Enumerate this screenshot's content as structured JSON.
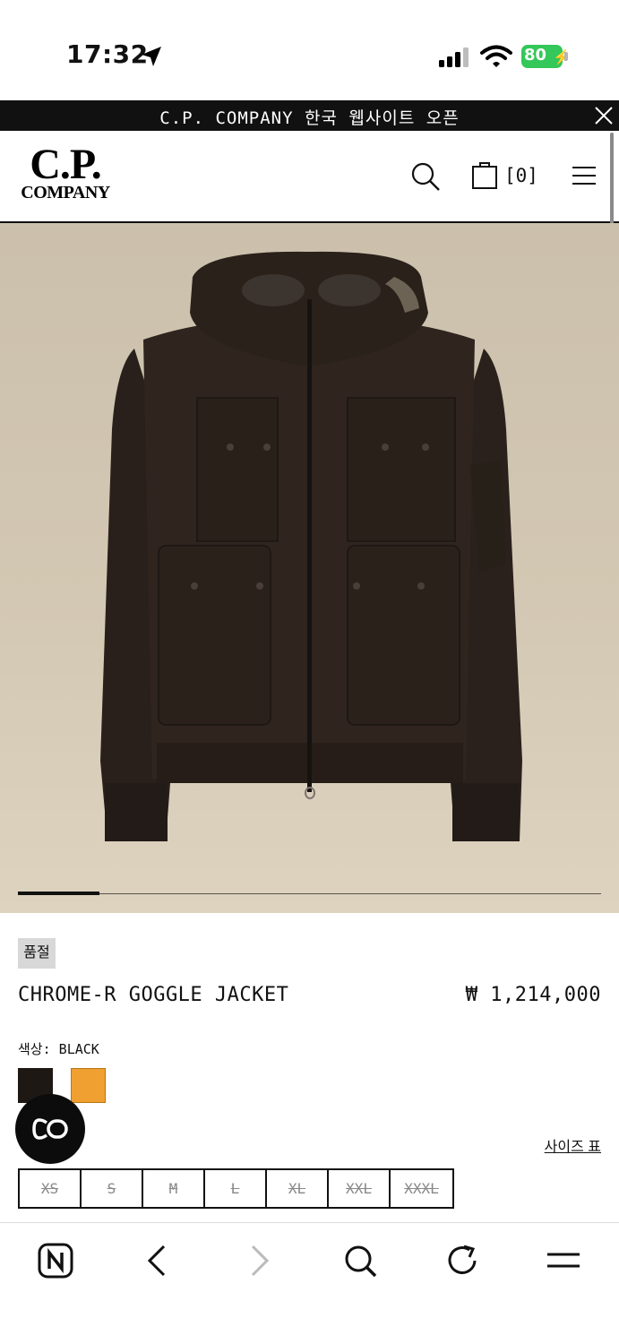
{
  "status_bar": {
    "time": "17:32",
    "battery": "80"
  },
  "announcement": {
    "text": "C.P. COMPANY 한국 웹사이트 오픈"
  },
  "header": {
    "logo_line1": "C.P.",
    "logo_line2": "COMPANY",
    "cart_count": "[0]"
  },
  "gallery": {
    "progress": 0.14
  },
  "product": {
    "badge": "품절",
    "name": "CHROME-R GOGGLE JACKET",
    "price": "₩ 1,214,000",
    "color_label": "색상: BLACK",
    "swatches": [
      {
        "name": "black",
        "hex": "#1e1815"
      },
      {
        "name": "orange",
        "hex": "#f0a030"
      }
    ],
    "size_chart_label": "사이즈 표",
    "sizes": [
      {
        "label": "XS",
        "available": false
      },
      {
        "label": "S",
        "available": false
      },
      {
        "label": "M",
        "available": false
      },
      {
        "label": "L",
        "available": false
      },
      {
        "label": "XL",
        "available": false
      },
      {
        "label": "XXL",
        "available": false
      },
      {
        "label": "XXXL",
        "available": false
      }
    ]
  },
  "colors": {
    "status_green": "#34c759",
    "announce_bg": "#111111",
    "hero_bg": "#d3c8b3"
  },
  "icons": [
    "location-arrow-icon",
    "signal-icon",
    "wifi-icon",
    "battery-icon",
    "close-icon",
    "search-icon",
    "shopping-bag-icon",
    "hamburger-menu-icon",
    "chat-icon",
    "naver-home-icon",
    "back-arrow-icon",
    "forward-arrow-icon",
    "browser-search-icon",
    "refresh-icon",
    "browser-menu-icon"
  ]
}
